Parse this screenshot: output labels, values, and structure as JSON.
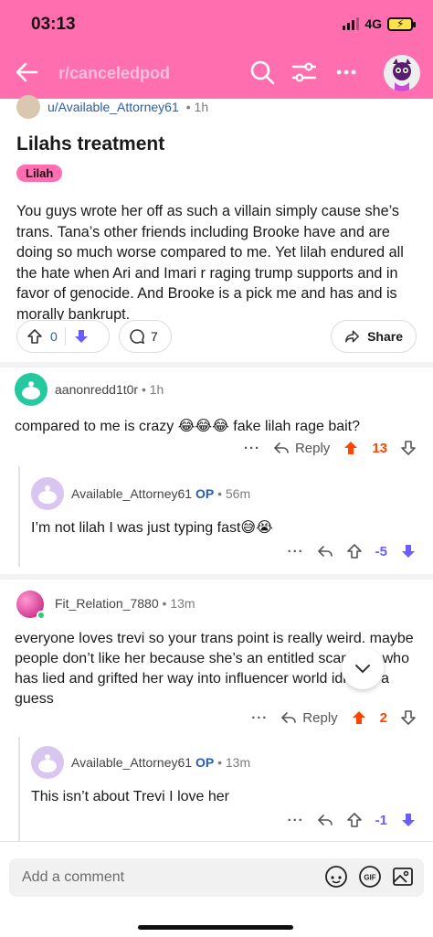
{
  "status": {
    "time": "03:13",
    "network": "4G"
  },
  "header": {
    "subreddit": "r/canceledpod"
  },
  "post": {
    "author": "u/Available_Attorney61",
    "time": "1h",
    "title": "Lilahs treatment",
    "flair": "Lilah",
    "body": "You guys wrote her off as such a villain simply cause she’s trans. Tana’s other friends including Brooke have and are doing so much worse compared to me. Yet lilah endured all the hate when Ari and Imari r raging trump supports and in favor of genocide. And Brooke is a pick me and has and is morally bankrupt.",
    "votes": "0",
    "comments": "7",
    "share_label": "Share"
  },
  "comments": [
    {
      "author": "aanonredd1t0r",
      "time": "1h",
      "body": "compared to me is crazy 😂😂😂 fake lilah rage bait?",
      "reply_label": "Reply",
      "votes": "13"
    },
    {
      "author": "Available_Attorney61",
      "op": "OP",
      "time": "56m",
      "body": "I’m not lilah I was just typing fast😅😭",
      "votes": "-5"
    },
    {
      "author": "Fit_Relation_7880",
      "time": "13m",
      "body": "everyone loves trevi so your trans point is really weird. maybe people don’t like her because she’s an entitled scammer who has lied and grifted her way into influencer world idk just a guess",
      "reply_label": "Reply",
      "votes": "2"
    },
    {
      "author": "Available_Attorney61",
      "op": "OP",
      "time": "13m",
      "body": "This isn’t about Trevi I love her",
      "votes": "-1"
    }
  ],
  "composer": {
    "placeholder": "Add a comment"
  },
  "colors": {
    "header": "#ff6fb0",
    "upvote": "#ff4500",
    "downvote": "#6a5cff",
    "link": "#2b5ea6"
  }
}
